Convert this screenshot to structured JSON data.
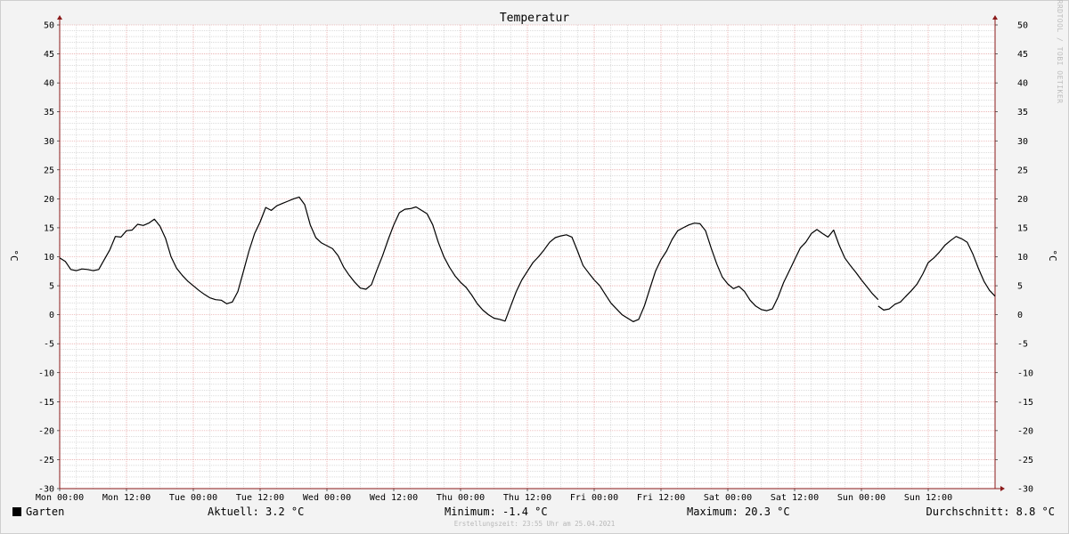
{
  "chart_data": {
    "type": "line",
    "title": "Temperatur",
    "ylabel": "°C",
    "y2label": "°C",
    "ylim": [
      -30,
      50
    ],
    "yticks": [
      50,
      45,
      40,
      35,
      30,
      25,
      20,
      15,
      10,
      5,
      0,
      -5,
      -10,
      -15,
      -20,
      -25,
      -30
    ],
    "xlim": [
      0,
      168
    ],
    "x_unit": "hours since Mon 00:00",
    "xticks": [
      {
        "x": 0,
        "label": "Mon 00:00"
      },
      {
        "x": 12,
        "label": "Mon 12:00"
      },
      {
        "x": 24,
        "label": "Tue 00:00"
      },
      {
        "x": 36,
        "label": "Tue 12:00"
      },
      {
        "x": 48,
        "label": "Wed 00:00"
      },
      {
        "x": 60,
        "label": "Wed 12:00"
      },
      {
        "x": 72,
        "label": "Thu 00:00"
      },
      {
        "x": 84,
        "label": "Thu 12:00"
      },
      {
        "x": 96,
        "label": "Fri 00:00"
      },
      {
        "x": 108,
        "label": "Fri 12:00"
      },
      {
        "x": 120,
        "label": "Sat 00:00"
      },
      {
        "x": 132,
        "label": "Sat 12:00"
      },
      {
        "x": 144,
        "label": "Sun 00:00"
      },
      {
        "x": 156,
        "label": "Sun 12:00"
      }
    ],
    "grid": true,
    "series": [
      {
        "name": "Garten",
        "color": "#000000",
        "segments": [
          [
            [
              0,
              9.8
            ],
            [
              1,
              9.2
            ],
            [
              2,
              7.8
            ],
            [
              3,
              7.6
            ],
            [
              4,
              7.9
            ],
            [
              5,
              7.8
            ],
            [
              6,
              7.6
            ],
            [
              7,
              7.8
            ],
            [
              8,
              9.5
            ],
            [
              9,
              11.2
            ],
            [
              10,
              13.5
            ],
            [
              11,
              13.4
            ],
            [
              12,
              14.5
            ],
            [
              13,
              14.6
            ],
            [
              14,
              15.6
            ],
            [
              15,
              15.4
            ],
            [
              16,
              15.8
            ],
            [
              17,
              16.5
            ],
            [
              18,
              15.3
            ],
            [
              19,
              13.2
            ],
            [
              20,
              10.0
            ],
            [
              21,
              8.0
            ],
            [
              22,
              6.8
            ],
            [
              23,
              5.8
            ],
            [
              24,
              5.0
            ],
            [
              25,
              4.2
            ],
            [
              26,
              3.5
            ],
            [
              27,
              2.9
            ],
            [
              28,
              2.6
            ],
            [
              29,
              2.5
            ],
            [
              30,
              1.9
            ],
            [
              31,
              2.2
            ],
            [
              32,
              4.0
            ],
            [
              33,
              7.5
            ],
            [
              34,
              11.0
            ],
            [
              35,
              14.0
            ],
            [
              36,
              16.0
            ],
            [
              37,
              18.5
            ],
            [
              38,
              18.0
            ],
            [
              39,
              18.8
            ],
            [
              40,
              19.2
            ],
            [
              41,
              19.6
            ],
            [
              42,
              20.0
            ],
            [
              43,
              20.3
            ],
            [
              44,
              19.0
            ],
            [
              45,
              15.5
            ],
            [
              46,
              13.3
            ],
            [
              47,
              12.4
            ],
            [
              48,
              11.9
            ],
            [
              49,
              11.4
            ],
            [
              50,
              10.2
            ],
            [
              51,
              8.2
            ],
            [
              52,
              6.8
            ],
            [
              53,
              5.6
            ],
            [
              54,
              4.6
            ],
            [
              55,
              4.4
            ],
            [
              56,
              5.2
            ],
            [
              57,
              7.8
            ],
            [
              58,
              10.2
            ],
            [
              59,
              13.0
            ],
            [
              60,
              15.5
            ],
            [
              61,
              17.6
            ],
            [
              62,
              18.2
            ],
            [
              63,
              18.3
            ],
            [
              64,
              18.6
            ],
            [
              65,
              18.0
            ],
            [
              66,
              17.4
            ],
            [
              67,
              15.5
            ],
            [
              68,
              12.5
            ],
            [
              69,
              10.0
            ],
            [
              70,
              8.2
            ],
            [
              71,
              6.7
            ],
            [
              72,
              5.6
            ],
            [
              73,
              4.7
            ],
            [
              74,
              3.4
            ],
            [
              75,
              1.9
            ],
            [
              76,
              0.8
            ],
            [
              77,
              0.0
            ],
            [
              78,
              -0.6
            ],
            [
              79,
              -0.8
            ],
            [
              80,
              -1.1
            ],
            [
              81,
              1.5
            ],
            [
              82,
              4.0
            ],
            [
              83,
              6.0
            ],
            [
              84,
              7.5
            ],
            [
              85,
              9.0
            ],
            [
              86,
              10.0
            ],
            [
              87,
              11.2
            ],
            [
              88,
              12.5
            ],
            [
              89,
              13.3
            ],
            [
              90,
              13.6
            ],
            [
              91,
              13.8
            ],
            [
              92,
              13.4
            ],
            [
              93,
              11.0
            ],
            [
              94,
              8.5
            ],
            [
              95,
              7.2
            ],
            [
              96,
              6.0
            ],
            [
              97,
              5.0
            ],
            [
              98,
              3.5
            ],
            [
              99,
              2.0
            ],
            [
              100,
              1.0
            ],
            [
              101,
              0.0
            ],
            [
              102,
              -0.6
            ],
            [
              103,
              -1.2
            ],
            [
              104,
              -0.8
            ],
            [
              105,
              1.5
            ],
            [
              106,
              4.5
            ],
            [
              107,
              7.5
            ],
            [
              108,
              9.5
            ],
            [
              109,
              11.0
            ],
            [
              110,
              13.0
            ],
            [
              111,
              14.5
            ],
            [
              112,
              15.0
            ],
            [
              113,
              15.5
            ],
            [
              114,
              15.8
            ],
            [
              115,
              15.7
            ],
            [
              116,
              14.5
            ],
            [
              117,
              11.5
            ],
            [
              118,
              8.8
            ],
            [
              119,
              6.5
            ],
            [
              120,
              5.3
            ],
            [
              121,
              4.5
            ],
            [
              122,
              4.9
            ],
            [
              123,
              4.0
            ],
            [
              124,
              2.5
            ],
            [
              125,
              1.5
            ],
            [
              126,
              0.9
            ],
            [
              127,
              0.7
            ],
            [
              128,
              1.0
            ],
            [
              129,
              3.0
            ],
            [
              130,
              5.5
            ],
            [
              131,
              7.5
            ],
            [
              132,
              9.5
            ],
            [
              133,
              11.5
            ],
            [
              134,
              12.5
            ],
            [
              135,
              14.0
            ],
            [
              136,
              14.7
            ],
            [
              137,
              14.0
            ],
            [
              138,
              13.4
            ],
            [
              139,
              14.6
            ],
            [
              140,
              12.0
            ],
            [
              141,
              9.8
            ],
            [
              142,
              8.5
            ],
            [
              143,
              7.3
            ],
            [
              144,
              6.0
            ],
            [
              145,
              4.8
            ],
            [
              146,
              3.6
            ],
            [
              147,
              2.6
            ]
          ],
          [
            [
              147,
              1.5
            ],
            [
              148,
              0.8
            ],
            [
              149,
              1.0
            ],
            [
              150,
              1.8
            ],
            [
              151,
              2.2
            ],
            [
              152,
              3.2
            ],
            [
              153,
              4.2
            ],
            [
              154,
              5.3
            ],
            [
              155,
              7.0
            ],
            [
              156,
              9.0
            ],
            [
              157,
              9.8
            ],
            [
              158,
              10.8
            ],
            [
              159,
              12.0
            ],
            [
              160,
              12.8
            ],
            [
              161,
              13.5
            ],
            [
              162,
              13.1
            ],
            [
              163,
              12.5
            ],
            [
              164,
              10.5
            ],
            [
              165,
              8.0
            ],
            [
              166,
              5.8
            ],
            [
              167,
              4.2
            ],
            [
              168,
              3.2
            ]
          ]
        ]
      }
    ]
  },
  "watermark": "RRDTOOL / TOBI OETIKER",
  "legend": {
    "series_name": "Garten",
    "current": "Aktuell: 3.2 °C",
    "minimum": "Minimum: -1.4 °C",
    "maximum": "Maximum: 20.3 °C",
    "average": "Durchschnitt: 8.8 °C"
  },
  "footer": "Erstellungszeit: 23:55 Uhr am 25.04.2021"
}
